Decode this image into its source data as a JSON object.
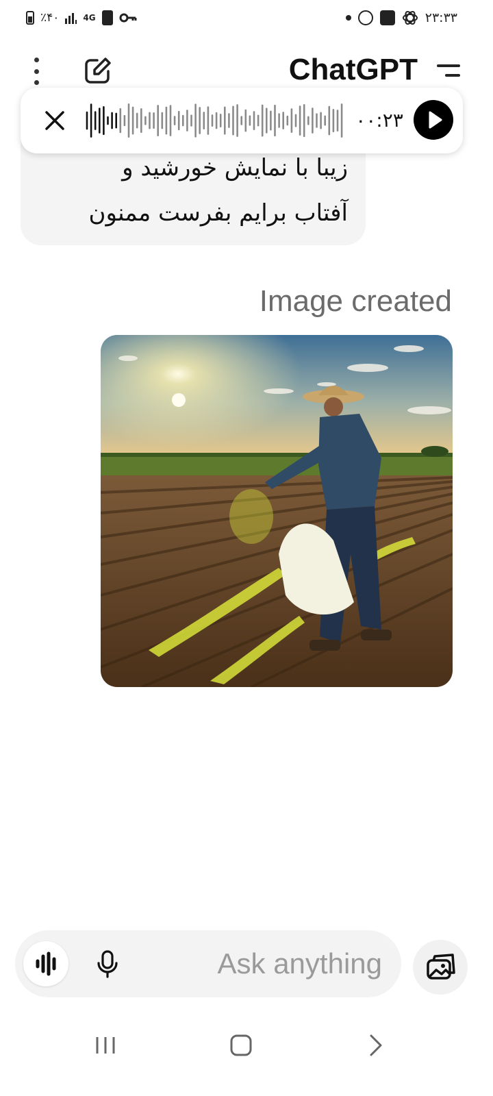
{
  "status_bar": {
    "battery": "٪۴۰",
    "network": "4G",
    "time": "۲۳:۳۳",
    "icons": [
      "battery-icon",
      "signal-icon",
      "network-4g-icon",
      "save-icon",
      "key-icon",
      "dot-icon",
      "whatsapp-icon",
      "gallery-icon",
      "chatgpt-icon"
    ]
  },
  "header": {
    "title": "ChatGPT",
    "icons": [
      "more-vertical-icon",
      "new-chat-icon",
      "sidebar-menu-icon"
    ]
  },
  "audio_player": {
    "time": "۰۰:۲۳",
    "icons": [
      "close-icon",
      "waveform-icon",
      "play-icon"
    ]
  },
  "conversation": {
    "user_message_lines": [
      "زیبا با نمایش خورشید و",
      "آفتاب برایم بفرست ممنون"
    ],
    "image_status": "Image created",
    "image_subject": "farmer-spreading-fertilizer-field-sunset"
  },
  "composer": {
    "placeholder": "Ask anything",
    "icons": [
      "voice-mode-icon",
      "microphone-icon",
      "image-attach-icon"
    ]
  },
  "nav_bar": {
    "icons": [
      "recents-icon",
      "home-icon",
      "back-icon"
    ]
  },
  "colors": {
    "background": "#ffffff",
    "bubble": "#f4f4f4",
    "composer": "#f3f3f3",
    "text": "#111111",
    "muted": "#6b6b6b",
    "sky": "#4a7ea8",
    "soil": "#5c3f24",
    "fertilizer": "#d8e23a"
  }
}
